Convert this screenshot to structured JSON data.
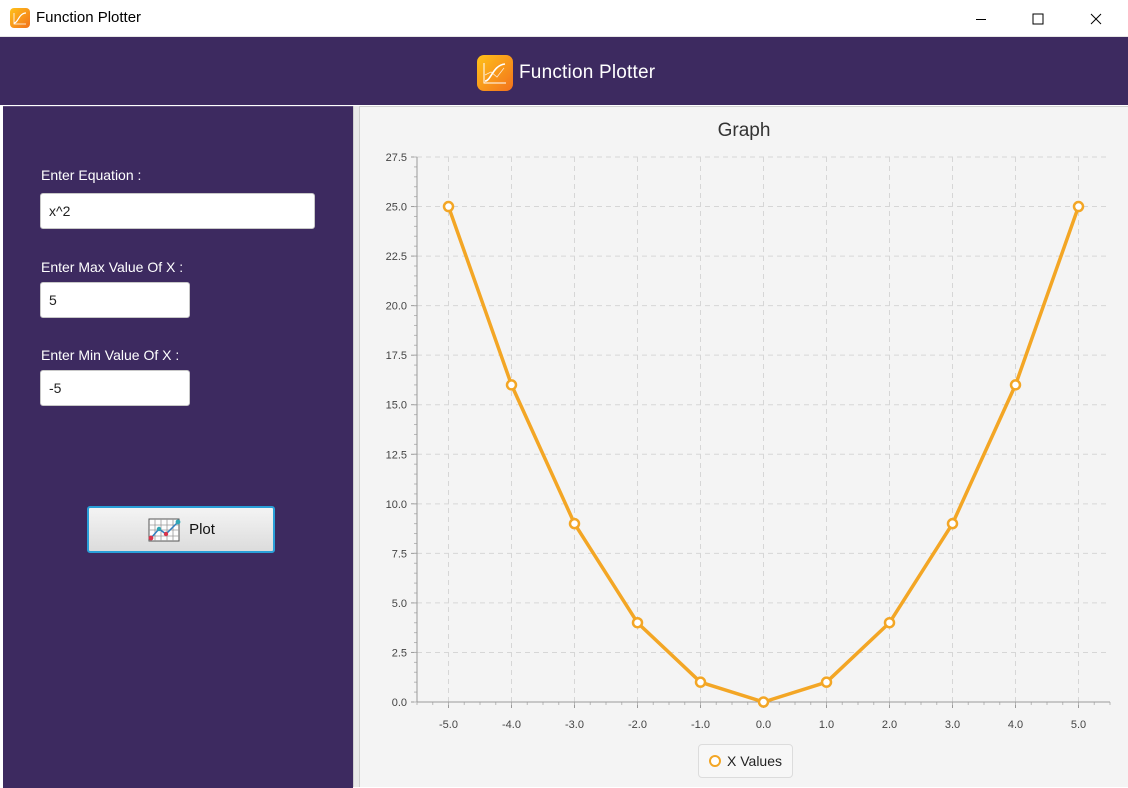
{
  "window": {
    "title": "Function Plotter",
    "controls": [
      "minimize",
      "maximize",
      "close"
    ]
  },
  "header": {
    "title": "Function Plotter",
    "icon": "function-plot-app-icon",
    "background": "#3d2a60"
  },
  "form": {
    "equation_label": "Enter Equation :",
    "equation_value": "x^2",
    "max_label": "Enter Max Value Of X :",
    "max_value": "5",
    "min_label": "Enter Min Value Of X :",
    "min_value": "-5",
    "plot_button_label": "Plot",
    "plot_button_icon": "chart-grid-icon"
  },
  "colors": {
    "panel": "#3d2a60",
    "series": "#f3a625",
    "button_border": "#2a9fd8"
  },
  "chart_data": {
    "type": "line",
    "title": "Graph",
    "xlabel": "",
    "ylabel": "",
    "xlim": [
      -5.5,
      5.5
    ],
    "ylim": [
      0,
      27.5
    ],
    "x_ticks": [
      "-5.0",
      "-4.0",
      "-3.0",
      "-2.0",
      "-1.0",
      "0.0",
      "1.0",
      "2.0",
      "3.0",
      "4.0",
      "5.0"
    ],
    "y_ticks": [
      "0.0",
      "2.5",
      "5.0",
      "7.5",
      "10.0",
      "12.5",
      "15.0",
      "17.5",
      "20.0",
      "22.5",
      "25.0",
      "27.5"
    ],
    "grid": true,
    "legend": "bottom-center",
    "series": [
      {
        "name": "X Values",
        "color": "#f3a625",
        "x": [
          -5,
          -4,
          -3,
          -2,
          -1,
          0,
          1,
          2,
          3,
          4,
          5
        ],
        "y": [
          25,
          16,
          9,
          4,
          1,
          0,
          1,
          4,
          9,
          16,
          25
        ]
      }
    ]
  }
}
